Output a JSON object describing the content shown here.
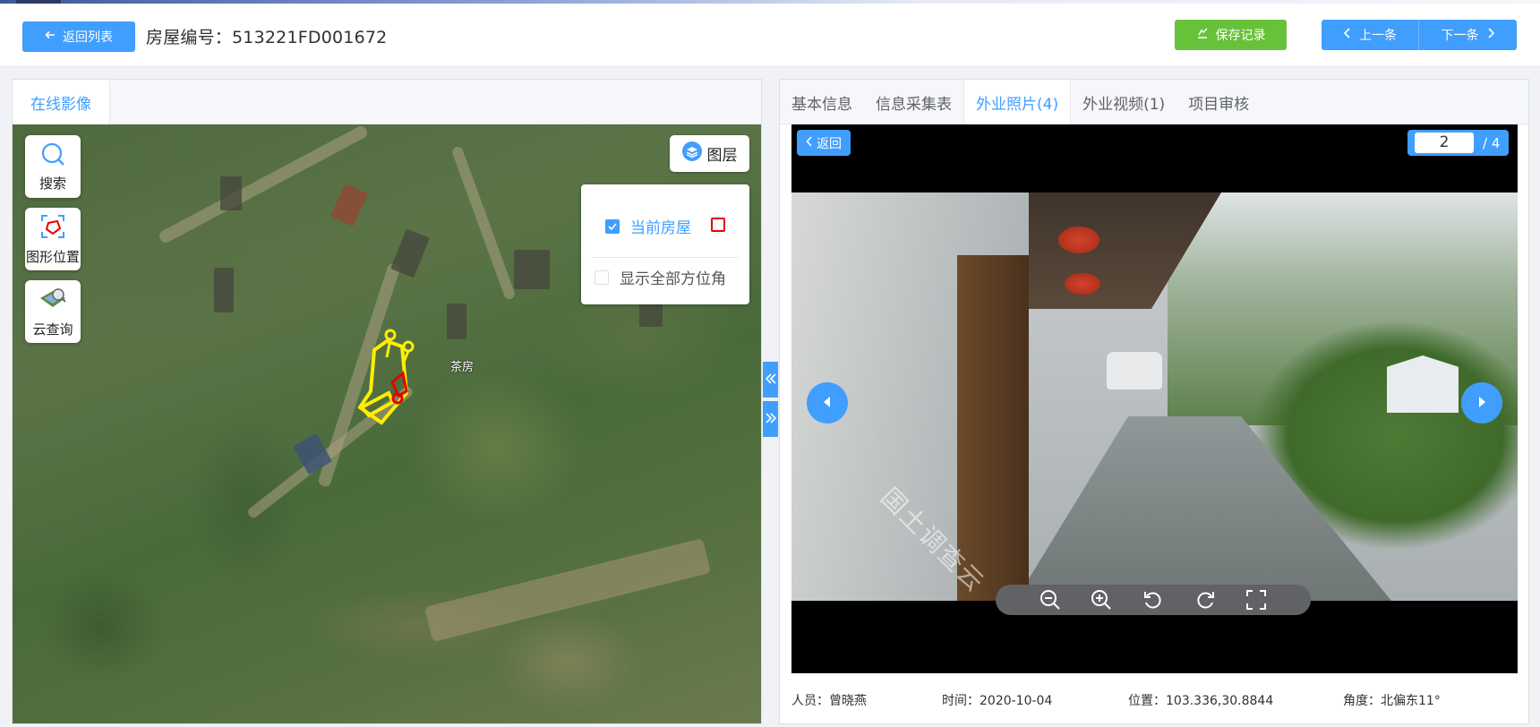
{
  "header": {
    "back_label": "返回列表",
    "house_label": "房屋编号：",
    "house_id": "513221FD001672",
    "save_label": "保存记录",
    "prev_label": "上一条",
    "next_label": "下一条"
  },
  "left": {
    "tab": "在线影像",
    "tools": {
      "search": "搜索",
      "shape_location": "图形位置",
      "cloud_query": "云查询"
    },
    "layer_button": "图层",
    "layers": {
      "current_house": "当前房屋",
      "show_all_orientation": "显示全部方位角",
      "current_house_checked": true,
      "show_all_checked": false
    },
    "map_label": "茶房"
  },
  "right": {
    "tabs": [
      "基本信息",
      "信息采集表",
      "外业照片(4)",
      "外业视频(1)",
      "项目审核"
    ],
    "active_tab_index": 2,
    "viewer": {
      "back_label": "返回",
      "current_page": "2",
      "total_pages": "/ 4",
      "watermark": "国土调查云"
    },
    "info": {
      "person": "人员：曾晓燕",
      "time": "时间：2020-10-04",
      "location": "位置：103.336,30.8844",
      "angle": "角度：北偏东11°"
    }
  },
  "colors": {
    "primary": "#409eff",
    "success": "#67c23a",
    "toolbar": "#606266",
    "shape_yellow": "#ffee00",
    "shape_red": "#e60000"
  }
}
